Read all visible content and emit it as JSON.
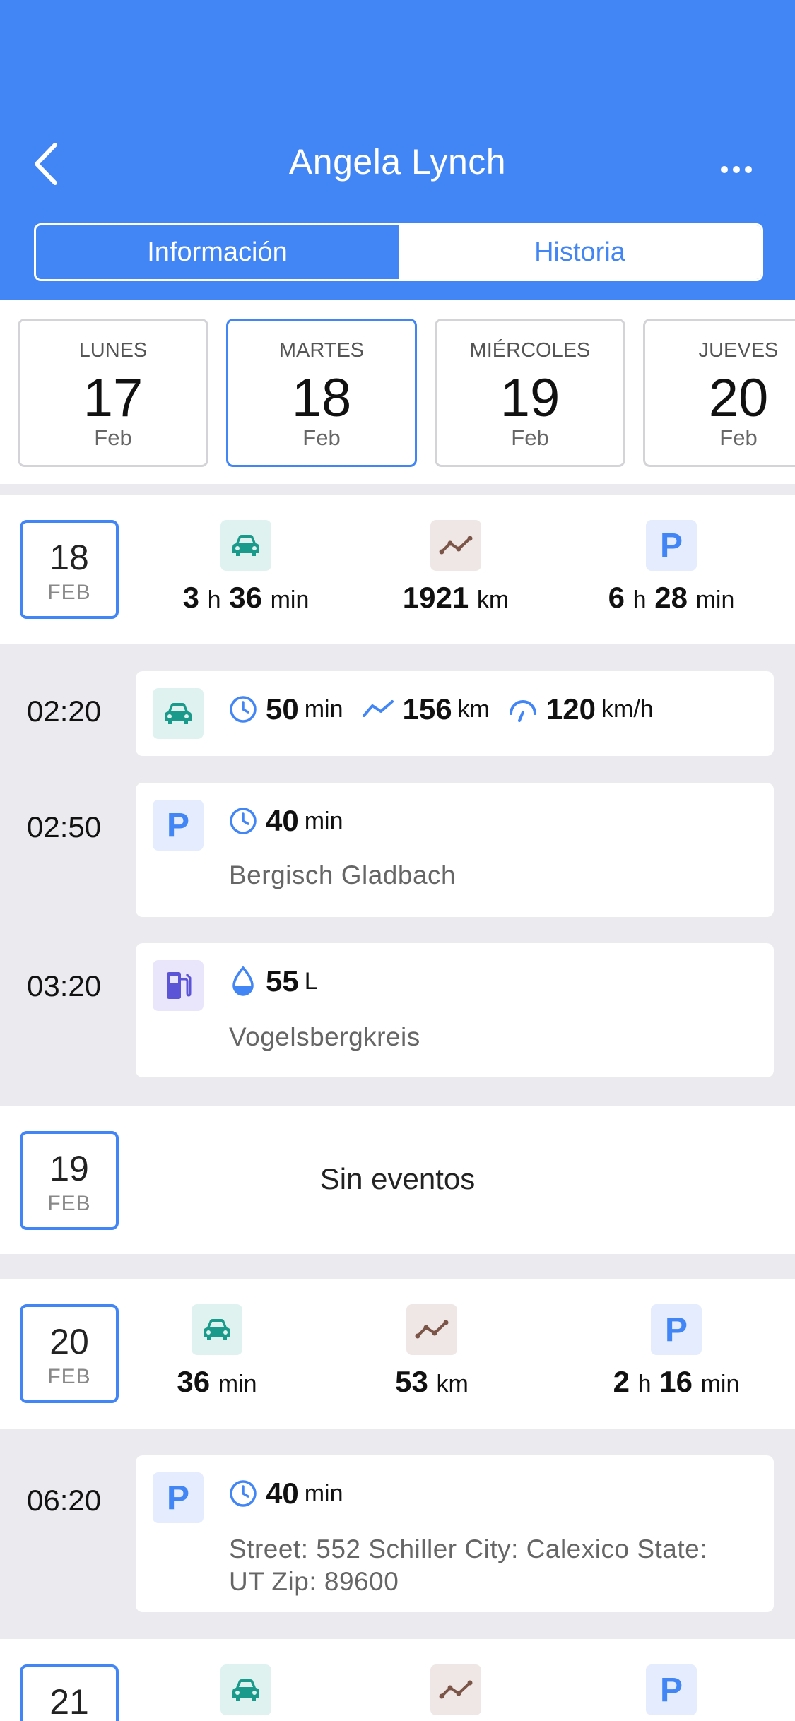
{
  "header": {
    "title": "Angela Lynch",
    "tabs": [
      "Información",
      "Historia"
    ],
    "active_tab": "Historia",
    "color": "#4285f4"
  },
  "date_strip": [
    {
      "day": "LUNES",
      "num": "17",
      "mon": "Feb"
    },
    {
      "day": "MARTES",
      "num": "18",
      "mon": "Feb",
      "selected": true
    },
    {
      "day": "MIÉRCOLES",
      "num": "19",
      "mon": "Feb"
    },
    {
      "day": "JUEVES",
      "num": "20",
      "mon": "Feb"
    }
  ],
  "day18": {
    "num": "18",
    "mon": "FEB",
    "drive": {
      "h": "3",
      "h_unit": "h",
      "m": "36",
      "m_unit": "min"
    },
    "distance": {
      "v": "1921",
      "unit": "km"
    },
    "park": {
      "h": "6",
      "h_unit": "h",
      "m": "28",
      "m_unit": "min"
    },
    "events": [
      {
        "time": "02:20",
        "type": "drive",
        "duration": "50",
        "duration_unit": "min",
        "distance": "156",
        "distance_unit": "km",
        "speed": "120",
        "speed_unit": "km/h"
      },
      {
        "time": "02:50",
        "type": "parking",
        "duration": "40",
        "duration_unit": "min",
        "location": "Bergisch Gladbach"
      },
      {
        "time": "03:20",
        "type": "fuel",
        "amount": "55",
        "amount_unit": "L",
        "location": "Vogelsbergkreis"
      }
    ]
  },
  "day19": {
    "num": "19",
    "mon": "FEB",
    "message": "Sin eventos"
  },
  "day20": {
    "num": "20",
    "mon": "FEB",
    "drive": {
      "m": "36",
      "m_unit": "min"
    },
    "distance": {
      "v": "53",
      "unit": "km"
    },
    "park": {
      "h": "2",
      "h_unit": "h",
      "m": "16",
      "m_unit": "min"
    },
    "events": [
      {
        "time": "06:20",
        "type": "parking",
        "duration": "40",
        "duration_unit": "min",
        "address_line1": "Street: 552 Schiller City: Calexico State:",
        "address_line2": "UT Zip: 89600"
      }
    ]
  },
  "day21": {
    "num": "21"
  },
  "icons": {
    "car": "car-icon",
    "distance": "trend-line-icon",
    "parking": "parking-icon",
    "fuel": "fuel-pump-icon",
    "clock": "clock-icon",
    "route": "route-icon",
    "speed": "speedometer-icon",
    "drop": "water-drop-icon"
  },
  "colors": {
    "accent": "#4285f4",
    "teal": "#1a9a8a",
    "brown": "#7a5548",
    "purple": "#5c54d6"
  }
}
